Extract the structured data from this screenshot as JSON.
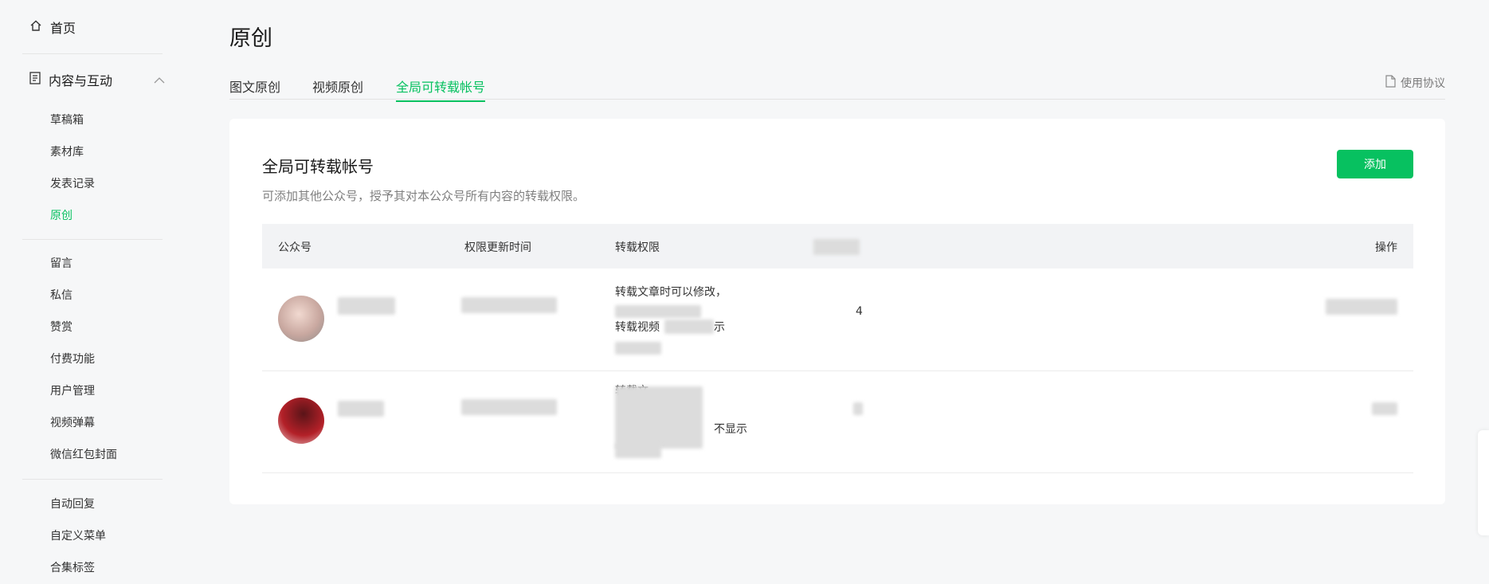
{
  "sidebar": {
    "home": "首页",
    "group": "内容与互动",
    "items": [
      "草稿箱",
      "素材库",
      "发表记录",
      "原创"
    ],
    "items2": [
      "留言",
      "私信",
      "赞赏",
      "付费功能",
      "用户管理",
      "视频弹幕",
      "微信红包封面"
    ],
    "items3": [
      "自动回复",
      "自定义菜单",
      "合集标签"
    ]
  },
  "page": {
    "title": "原创"
  },
  "tabs": [
    "图文原创",
    "视频原创",
    "全局可转载帐号"
  ],
  "agreement": "使用协议",
  "card": {
    "title": "全局可转载帐号",
    "desc": "可添加其他公众号，授予其对本公众号所有内容的转载权限。",
    "add_label": "添加"
  },
  "table": {
    "headers": [
      "公众号",
      "权限更新时间",
      "转载权限",
      "",
      "操作"
    ],
    "rows": [
      {
        "perm_line1": "转载文章时可以修改，",
        "perm_line2": "转载视频",
        "perm_suffix": "示",
        "count": "4"
      },
      {
        "perm_line1": "转载文",
        "perm_line2": "",
        "perm_suffix": "不显示",
        "count": ""
      }
    ]
  },
  "colors": {
    "accent": "#07c160"
  }
}
